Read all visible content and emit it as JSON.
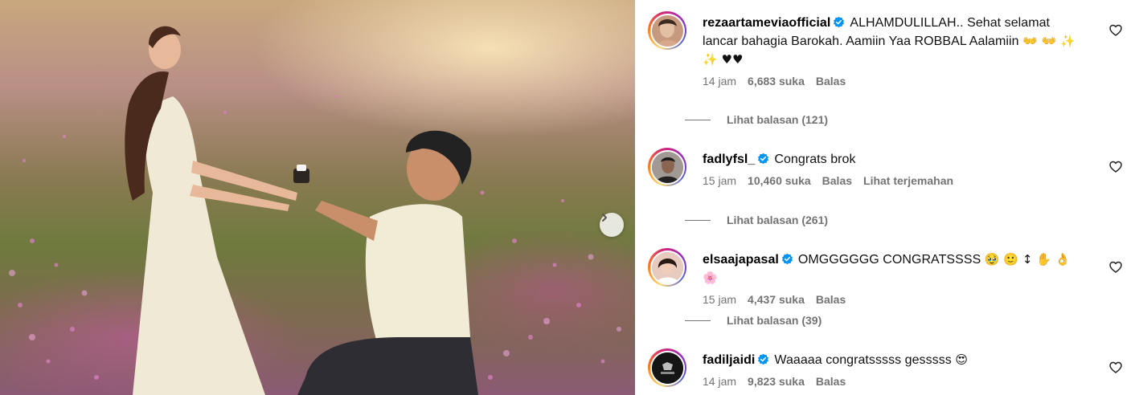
{
  "post": {
    "next_icon": "chevron-right-icon"
  },
  "comments": [
    {
      "username": "rezaartameviaofficial",
      "text": "ALHAMDULILLAH.. Sehat selamat lancar bahagia Barokah. Aamiin Yaa ROBBAL Aalamiin",
      "emojis": "👐 👐 ✨ ✨ ♥♥",
      "time": "14 jam",
      "likes": "6,683 suka",
      "reply_label": "Balas",
      "view_replies": "Lihat balasan (121)",
      "avatar_color": "#c79a7e"
    },
    {
      "username": "fadlyfsl_",
      "text": "Congrats brok",
      "emojis": "",
      "time": "15 jam",
      "likes": "10,460 suka",
      "reply_label": "Balas",
      "translate_label": "Lihat terjemahan",
      "view_replies": "Lihat balasan (261)",
      "avatar_color": "#5a5450"
    },
    {
      "username": "elsaajapasal",
      "text": "OMGGGGGG CONGRATSSSS",
      "emojis": "🥹 🙂 ↕ ✋ 👌 🌸",
      "time": "15 jam",
      "likes": "4,437 suka",
      "reply_label": "Balas",
      "view_replies": "Lihat balasan (39)",
      "avatar_color": "#d9b3a6"
    },
    {
      "username": "fadiljaidi",
      "text": "Waaaaa congratsssss gesssss",
      "emojis": "😍",
      "time": "14 jam",
      "likes": "9,823 suka",
      "reply_label": "Balas",
      "avatar_color": "#1c1c1c"
    }
  ],
  "colors": {
    "verified_blue": "#0095f6",
    "meta_gray": "#737373"
  }
}
